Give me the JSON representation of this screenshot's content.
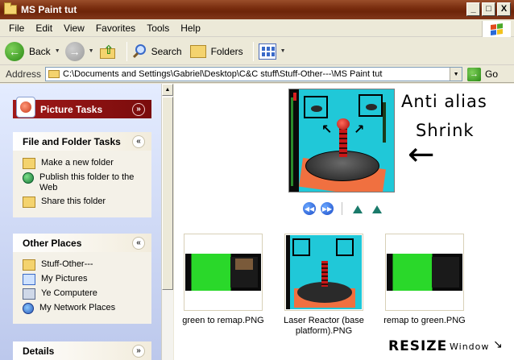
{
  "window": {
    "title": "MS Paint tut",
    "minimize": "_",
    "maximize": "□",
    "close": "X"
  },
  "menu": [
    "File",
    "Edit",
    "View",
    "Favorites",
    "Tools",
    "Help"
  ],
  "toolbar": {
    "back": "Back",
    "search": "Search",
    "folders": "Folders"
  },
  "address": {
    "label": "Address",
    "path": "C:\\Documents and Settings\\Gabriel\\Desktop\\C&C stuff\\Stuff-Other---\\MS Paint tut",
    "go": "Go"
  },
  "sidebar": {
    "picture_tasks": {
      "title": "Picture Tasks",
      "chevron": "»"
    },
    "file_tasks": {
      "title": "File and Folder Tasks",
      "chevron": "«",
      "items": [
        "Make a new folder",
        "Publish this folder to the Web",
        "Share this folder"
      ]
    },
    "other_places": {
      "title": "Other Places",
      "chevron": "«",
      "items": [
        "Stuff-Other---",
        "My Pictures",
        "Ye Computere",
        "My Network Places"
      ]
    },
    "details": {
      "title": "Details",
      "chevron": "»"
    }
  },
  "preview": {
    "annotation_line1": "Anti alias",
    "annotation_line2": "Shrink",
    "arrow": "←"
  },
  "files": [
    {
      "name": "green to remap.PNG"
    },
    {
      "name": "Laser Reactor (base platform).PNG"
    },
    {
      "name": "remap to green.PNG"
    }
  ],
  "resize_note": {
    "big": "RESIZE",
    "small": "Window",
    "arrow": "↘"
  }
}
